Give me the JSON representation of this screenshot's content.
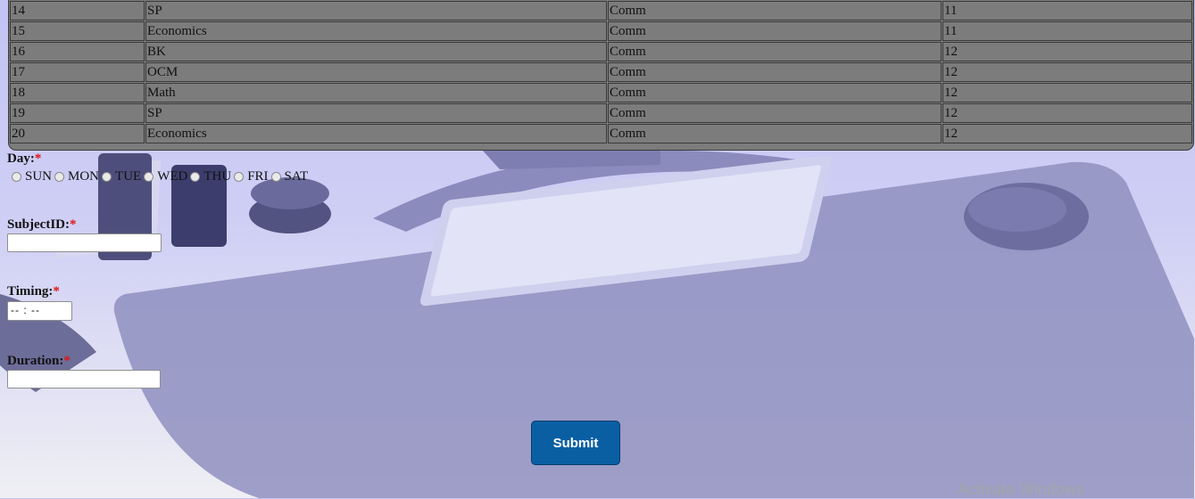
{
  "schedule_table": {
    "rows": [
      [
        "14",
        "SP",
        "Comm",
        "11"
      ],
      [
        "15",
        "Economics",
        "Comm",
        "11"
      ],
      [
        "16",
        "BK",
        "Comm",
        "12"
      ],
      [
        "17",
        "OCM",
        "Comm",
        "12"
      ],
      [
        "18",
        "Math",
        "Comm",
        "12"
      ],
      [
        "19",
        "SP",
        "Comm",
        "12"
      ],
      [
        "20",
        "Economics",
        "Comm",
        "12"
      ]
    ]
  },
  "form": {
    "day_label": "Day:",
    "required_mark": "*",
    "days": [
      "SUN",
      "MON",
      "TUE",
      "WED",
      "THU",
      "FRI",
      "SAT"
    ],
    "subject_label": "SubjectID:",
    "subject_value": "",
    "timing_label": "Timing:",
    "timing_value": "-- : --",
    "duration_label": "Duration:",
    "duration_value": "",
    "submit_label": "Submit"
  },
  "watermark": "Activate Windows",
  "colors": {
    "submit": "#0a5fa3",
    "required": "#e01515",
    "table_bg": "#7c7c7c"
  }
}
